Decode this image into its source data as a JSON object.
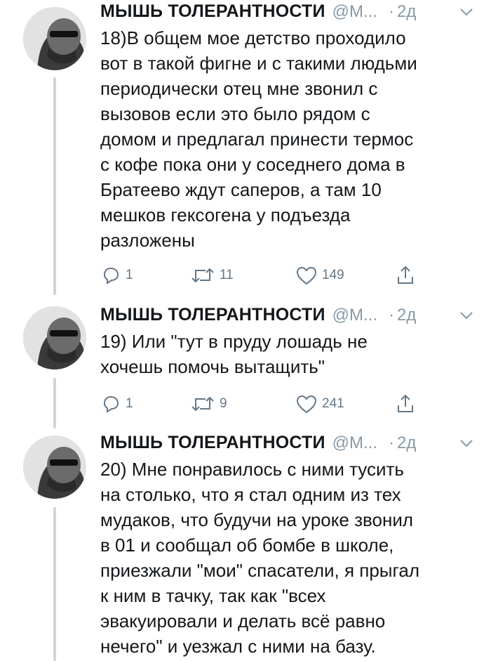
{
  "tweets": [
    {
      "name": "МЫШЬ ТОЛЕРАНТНОСТИ",
      "handle": "@М...",
      "dot": "·",
      "time": "2д",
      "text": "18)В общем мое детство проходило\nвот в такой фигне и с такими людьми\nпериодически отец мне звонил с\nвызовов если это было рядом с\nдомом и предлагал принести термос\nс кофе пока они у соседнего дома в\nБратеево ждут саперов, а там 10\nмешков гексогена у подъезда\nразложены",
      "replies": "1",
      "retweets": "11",
      "likes": "149"
    },
    {
      "name": "МЫШЬ ТОЛЕРАНТНОСТИ",
      "handle": "@М...",
      "dot": "·",
      "time": "2д",
      "text": "19) Или \"тут в пруду лошадь не\nхочешь помочь вытащить\"",
      "replies": "1",
      "retweets": "9",
      "likes": "241"
    },
    {
      "name": "МЫШЬ ТОЛЕРАНТНОСТИ",
      "handle": "@М...",
      "dot": "·",
      "time": "2д",
      "text": "20) Мне понравилось с ними тусить\nна столько, что я стал одним из тех\nмудаков, что будучи на уроке звонил\nв 01 и сообщал об бомбе в школе,\nприезжали \"мои\" спасатели, я прыгал\nк ним в тачку, так как \"всех\nэвакуировали и делать всё равно\nнечего\" и уезжал с ними на базу."
    }
  ],
  "icons": {
    "reply": "reply-icon",
    "retweet": "retweet-icon",
    "like": "heart-icon",
    "share": "share-icon",
    "menu": "chevron-down-icon"
  },
  "colors": {
    "text": "#14171a",
    "muted": "#8899a6",
    "action": "#657786",
    "thread_line": "#ccd6dd"
  }
}
